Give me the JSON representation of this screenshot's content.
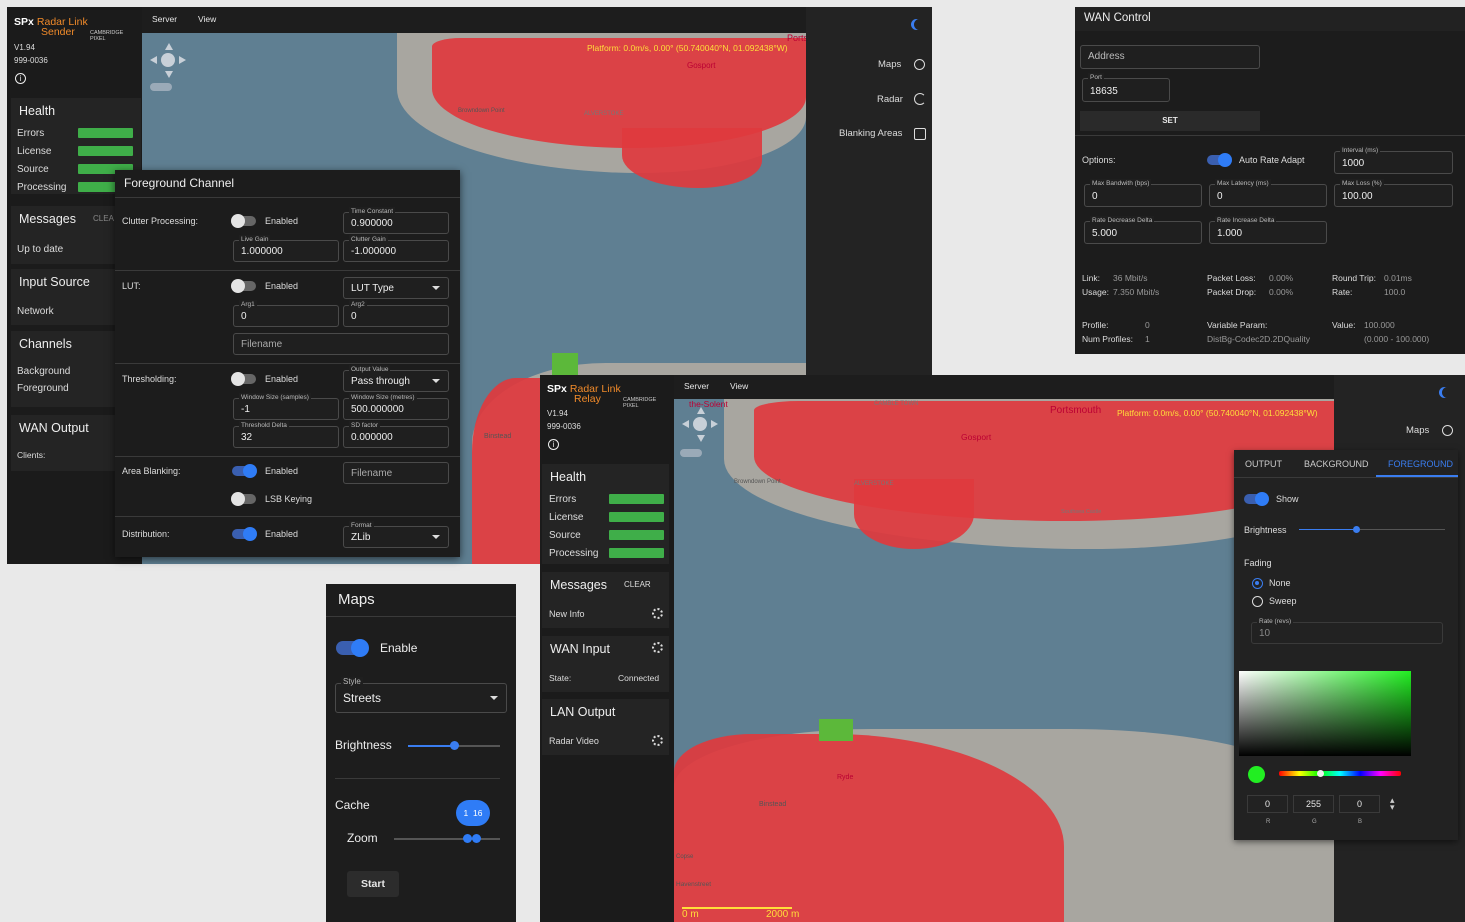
{
  "sender": {
    "brand": "SPx",
    "brand_accent": "Radar Link",
    "role": "Sender",
    "maker": "CAMBRIDGE PIXEL",
    "version": "V1.94",
    "code": "999-0036",
    "menu": [
      "Server",
      "View"
    ],
    "platform": "Platform: 0.0m/s, 0.00° (50.740040°N, 01.092438°W)",
    "map_labels": [
      "Portsm",
      "Gosport",
      "Browndown Point",
      "ALVERSTOKE",
      "Binstead"
    ],
    "right_items": [
      "Maps",
      "Radar",
      "Blanking Areas"
    ],
    "health": {
      "title": "Health",
      "items": [
        "Errors",
        "License",
        "Source",
        "Processing"
      ]
    },
    "messages": {
      "title": "Messages",
      "clear": "CLEA",
      "status": "Up to date"
    },
    "input": {
      "title": "Input Source",
      "value": "Network"
    },
    "channels": {
      "title": "Channels",
      "items": [
        "Background",
        "Foreground"
      ]
    },
    "wan": {
      "title": "WAN Output",
      "clients": "Clients:"
    }
  },
  "fg": {
    "title": "Foreground Channel",
    "clutter": {
      "label": "Clutter Processing:",
      "enabled": "Enabled",
      "tc_cap": "Time Constant",
      "tc": "0.900000",
      "lg_cap": "Live Gain",
      "lg": "1.000000",
      "cg_cap": "Clutter Gain",
      "cg": "-1.000000"
    },
    "lut": {
      "label": "LUT:",
      "enabled": "Enabled",
      "type": "LUT Type",
      "a1_cap": "Arg1",
      "a1": "0",
      "a2_cap": "Arg2",
      "a2": "0",
      "filename": "Filename"
    },
    "thr": {
      "label": "Thresholding:",
      "enabled": "Enabled",
      "ov_cap": "Output Value",
      "ov": "Pass through",
      "ws_cap": "Window Size (samples)",
      "ws": "-1",
      "wm_cap": "Window Size (metres)",
      "wm": "500.000000",
      "td_cap": "Threshold Delta",
      "td": "32",
      "sd_cap": "SD factor",
      "sd": "0.000000"
    },
    "area": {
      "label": "Area Blanking:",
      "enabled": "Enabled",
      "filename": "Filename",
      "lsb": "LSB Keying"
    },
    "dist": {
      "label": "Distribution:",
      "enabled": "Enabled",
      "fmt_cap": "Format",
      "fmt": "ZLib"
    }
  },
  "wan_ctrl": {
    "title": "WAN Control",
    "address": "Address",
    "port_cap": "Port",
    "port": "18635",
    "set": "SET",
    "options": "Options:",
    "auto": "Auto Rate Adapt",
    "interval_cap": "Interval (ms)",
    "interval": "1000",
    "mb_cap": "Max Bandwith (bps)",
    "mb": "0",
    "ml_cap": "Max Latency (ms)",
    "ml": "0",
    "mloss_cap": "Max Loss (%)",
    "mloss": "100.00",
    "rdd_cap": "Rate Decrease Delta",
    "rdd": "5.000",
    "rid_cap": "Rate Increase Delta",
    "rid": "1.000",
    "link_l": "Link:",
    "link": "36 Mbit/s",
    "usage_l": "Usage:",
    "usage": "7.350 Mbit/s",
    "pl_l": "Packet Loss:",
    "pl": "0.00%",
    "pd_l": "Packet Drop:",
    "pd": "0.00%",
    "rt_l": "Round Trip:",
    "rt": "0.01ms",
    "rate_l": "Rate:",
    "rate": "100.0",
    "profile_l": "Profile:",
    "profile": "0",
    "np_l": "Num Profiles:",
    "np": "1",
    "vp_l": "Variable Param:",
    "vp": "DistBg-Codec2D.2DQuality",
    "val_l": "Value:",
    "val": "100.000",
    "range": "(0.000 - 100.000)"
  },
  "maps": {
    "title": "Maps",
    "enable": "Enable",
    "style_cap": "Style",
    "style": "Streets",
    "brightness": "Brightness",
    "cache": "Cache",
    "zoom": "Zoom",
    "zoom_lo": "1",
    "zoom_hi": "16",
    "start": "Start"
  },
  "relay": {
    "brand": "SPx",
    "brand_accent": "Radar Link",
    "role": "Relay",
    "maker": "CAMBRIDGE PIXEL",
    "version": "V1.94",
    "code": "999-0036",
    "menu": [
      "Server",
      "View"
    ],
    "platform": "Platform: 0.0m/s, 0.00° (50.740040°N, 01.092438°W)",
    "map_labels": [
      "Portsmouth",
      "Gosport",
      "the-Solent",
      "CAMBLE TOWN",
      "Browndown Point",
      "ALVERSTOKE",
      "Southsea Castle",
      "Binstead",
      "Ryde",
      "Havenstreet",
      "Copse"
    ],
    "scale_l": "0 m",
    "scale_r": "2000 m",
    "right_item": "Maps",
    "health": {
      "title": "Health",
      "items": [
        "Errors",
        "License",
        "Source",
        "Processing"
      ]
    },
    "messages": {
      "title": "Messages",
      "clear": "CLEAR",
      "item": "New Info"
    },
    "wan_in": {
      "title": "WAN Input",
      "state_l": "State:",
      "state": "Connected"
    },
    "lan": {
      "title": "LAN Output",
      "item": "Radar Video"
    }
  },
  "radar": {
    "tabs": [
      "OUTPUT",
      "BACKGROUND",
      "FOREGROUND"
    ],
    "active_tab": "FOREGROUND",
    "show": "Show",
    "brightness": "Brightness",
    "fading": "Fading",
    "none": "None",
    "sweep": "Sweep",
    "rate_cap": "Rate (revs)",
    "rate": "10",
    "r": "0",
    "g": "255",
    "b": "0",
    "rl": "R",
    "gl": "G",
    "bl": "B",
    "color": "#22ee22"
  }
}
